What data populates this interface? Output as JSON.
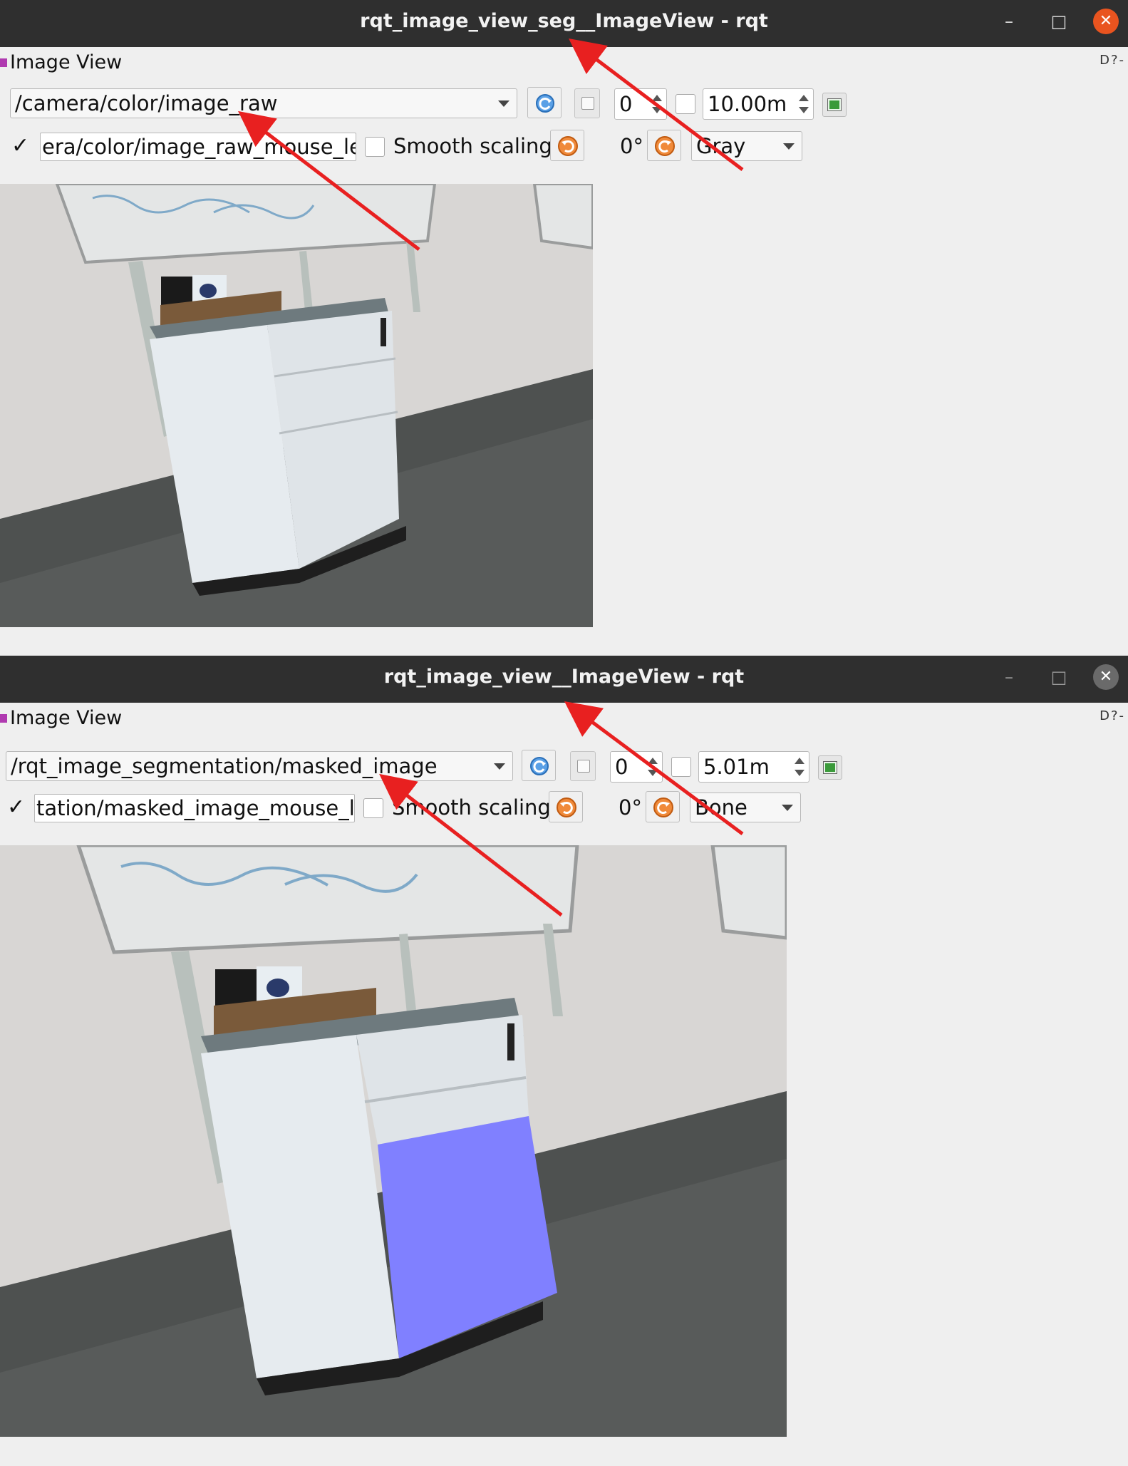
{
  "window1": {
    "title": "rqt_image_view_seg__ImageView - rqt",
    "plugin_label": "Image View",
    "plugin_tools": "D?-",
    "topic": "/camera/color/image_raw",
    "frame_value": "0",
    "max_range": "10.00m",
    "mouse_topic": "era/color/image_raw_mouse_left",
    "smooth_scaling_label": "Smooth scaling",
    "rotation": "0°",
    "colormap": "Gray",
    "mouse_checked": "✓"
  },
  "window2": {
    "title": "rqt_image_view__ImageView - rqt",
    "plugin_label": "Image View",
    "plugin_tools": "D?-",
    "topic": "/rqt_image_segmentation/masked_image",
    "frame_value": "0",
    "max_range": "5.01m",
    "mouse_topic": "tation/masked_image_mouse_left",
    "smooth_scaling_label": "Smooth scaling",
    "rotation": "0°",
    "colormap": "Bone",
    "mouse_checked": "✓"
  },
  "window_controls": {
    "minimize": "–",
    "maximize": "□",
    "close": "✕"
  },
  "colors": {
    "titlebar": "#2f2f2f",
    "close_active": "#e9541f",
    "annotation_arrow": "#e82020",
    "mask_overlay": "#8080ff"
  }
}
